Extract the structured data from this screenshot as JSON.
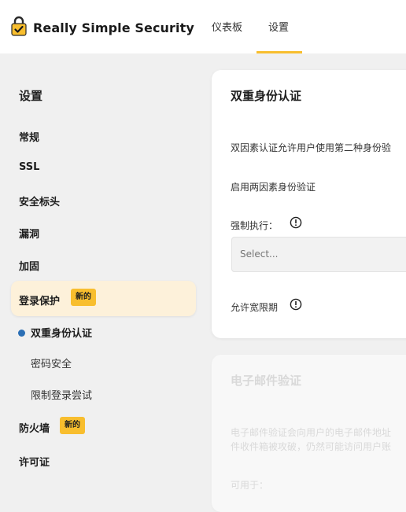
{
  "header": {
    "brand": "Really Simple Security",
    "nav": {
      "dashboard": "仪表板",
      "settings": "设置"
    },
    "colors": {
      "accent": "#f8be2e"
    }
  },
  "sidebar": {
    "title": "设置",
    "items": [
      {
        "label": "常规"
      },
      {
        "label": "SSL"
      },
      {
        "label": "安全标头"
      },
      {
        "label": "漏洞"
      },
      {
        "label": "加固"
      },
      {
        "label": "登录保护",
        "badge": "新的",
        "active": true
      },
      {
        "label": "防火墙",
        "badge": "新的"
      },
      {
        "label": "许可证"
      }
    ],
    "subitems": [
      {
        "label": "双重身份认证",
        "active": true
      },
      {
        "label": "密码安全"
      },
      {
        "label": "限制登录尝试"
      }
    ]
  },
  "main": {
    "two_factor": {
      "title": "双重身份认证",
      "description": "双因素认证允许用户使用第二种身份验",
      "enable_label": "启用两因素身份验证",
      "enforce_label": "强制执行：",
      "select_placeholder": "Select...",
      "grace_label": "允许宽限期"
    },
    "email_verification": {
      "title": "电子邮件验证",
      "description_line1": "电子邮件验证会向用户的电子邮件地址",
      "description_line2": "件收件箱被攻破，仍然可能访问用户账",
      "available_label": "可用于："
    }
  }
}
